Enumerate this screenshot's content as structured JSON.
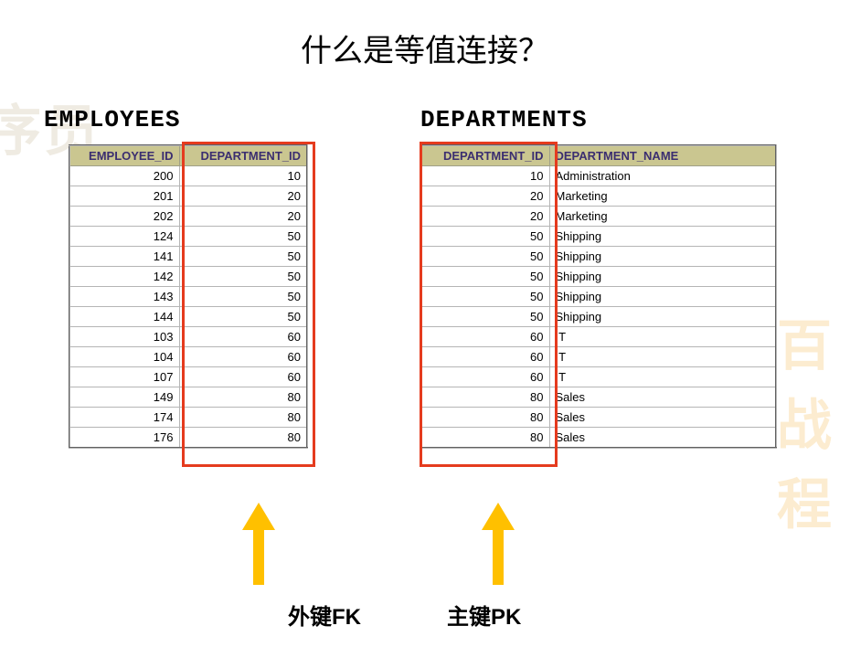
{
  "title": "什么是等值连接？",
  "watermark1": "序员",
  "watermark2": "百战程",
  "employees": {
    "title": "EMPLOYEES",
    "header": {
      "col1": "EMPLOYEE_ID",
      "col2": "DEPARTMENT_ID"
    },
    "rows": [
      {
        "col1": "200",
        "col2": "10"
      },
      {
        "col1": "201",
        "col2": "20"
      },
      {
        "col1": "202",
        "col2": "20"
      },
      {
        "col1": "124",
        "col2": "50"
      },
      {
        "col1": "141",
        "col2": "50"
      },
      {
        "col1": "142",
        "col2": "50"
      },
      {
        "col1": "143",
        "col2": "50"
      },
      {
        "col1": "144",
        "col2": "50"
      },
      {
        "col1": "103",
        "col2": "60"
      },
      {
        "col1": "104",
        "col2": "60"
      },
      {
        "col1": "107",
        "col2": "60"
      },
      {
        "col1": "149",
        "col2": "80"
      },
      {
        "col1": "174",
        "col2": "80"
      },
      {
        "col1": "176",
        "col2": "80"
      }
    ]
  },
  "departments": {
    "title": "DEPARTMENTS",
    "header": {
      "col1": "DEPARTMENT_ID",
      "col2": "DEPARTMENT_NAME"
    },
    "rows": [
      {
        "col1": "10",
        "col2": "Administration"
      },
      {
        "col1": "20",
        "col2": "Marketing"
      },
      {
        "col1": "20",
        "col2": "Marketing"
      },
      {
        "col1": "50",
        "col2": "Shipping"
      },
      {
        "col1": "50",
        "col2": "Shipping"
      },
      {
        "col1": "50",
        "col2": "Shipping"
      },
      {
        "col1": "50",
        "col2": "Shipping"
      },
      {
        "col1": "50",
        "col2": "Shipping"
      },
      {
        "col1": "60",
        "col2": "IT"
      },
      {
        "col1": "60",
        "col2": "IT"
      },
      {
        "col1": "60",
        "col2": "IT"
      },
      {
        "col1": "80",
        "col2": "Sales"
      },
      {
        "col1": "80",
        "col2": "Sales"
      },
      {
        "col1": "80",
        "col2": "Sales"
      }
    ]
  },
  "arrows": {
    "fk_label": "外键FK",
    "pk_label": "主键PK",
    "color": "#ffc000"
  }
}
